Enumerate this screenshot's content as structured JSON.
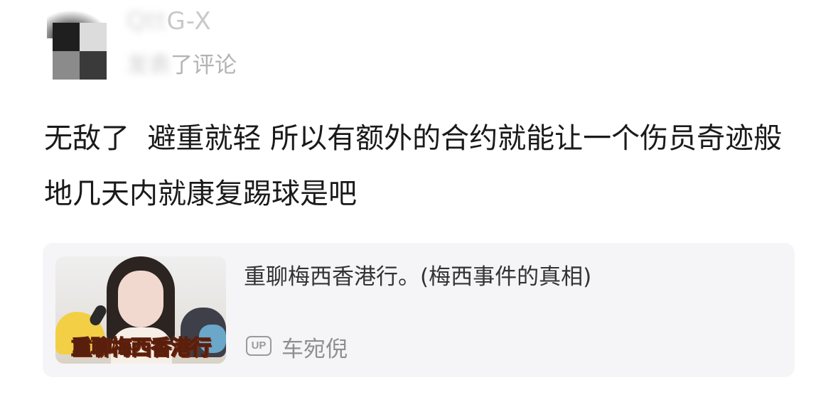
{
  "header": {
    "username_visible": "G-X",
    "action_text_visible": "了评论",
    "avatar_icon": "user-avatar-icon"
  },
  "comment": {
    "text": "无敌了  避重就轻 所以有额外的合约就能让一个伤员奇迹般地几天内就康复踢球是吧"
  },
  "link_card": {
    "thumbnail_caption": "重聊梅西香港行",
    "title": "重聊梅西香港行。(梅西事件的真相)",
    "up_badge": "UP",
    "uploader": "车宛倪"
  },
  "colors": {
    "card_background": "#f5f5f7",
    "text_primary": "#1a1a1a",
    "text_secondary": "#8f8f8f",
    "caption_yellow": "#f2c21b"
  }
}
